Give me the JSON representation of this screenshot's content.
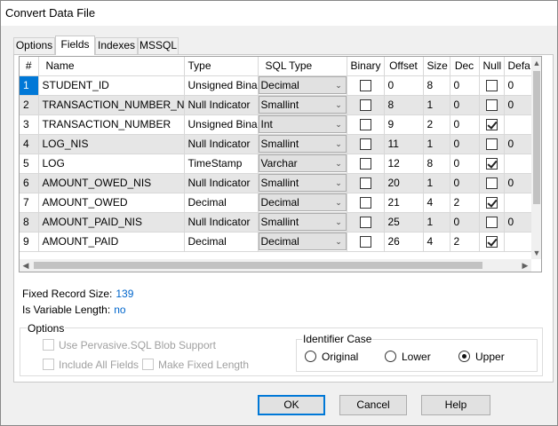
{
  "window": {
    "title": "Convert Data File"
  },
  "tabs": [
    {
      "label": "Options"
    },
    {
      "label": "Fields",
      "active": true
    },
    {
      "label": "Indexes"
    },
    {
      "label": "MSSQL"
    }
  ],
  "grid": {
    "columns": [
      "#",
      "Name",
      "Type",
      "SQL Type",
      "Binary",
      "Offset",
      "Size",
      "Dec",
      "Null",
      "Defa"
    ],
    "rows": [
      {
        "num": "1",
        "name": "STUDENT_ID",
        "type": "Unsigned Binary",
        "sql_type": "Decimal",
        "binary": false,
        "offset": "0",
        "size": "8",
        "dec": "0",
        "null": false,
        "default": "0"
      },
      {
        "num": "2",
        "name": "TRANSACTION_NUMBER_NIS",
        "type": "Null Indicator",
        "sql_type": "Smallint",
        "binary": false,
        "offset": "8",
        "size": "1",
        "dec": "0",
        "null": false,
        "default": "0"
      },
      {
        "num": "3",
        "name": "TRANSACTION_NUMBER",
        "type": "Unsigned Binary",
        "sql_type": "Int",
        "binary": false,
        "offset": "9",
        "size": "2",
        "dec": "0",
        "null": true,
        "default": ""
      },
      {
        "num": "4",
        "name": "LOG_NIS",
        "type": "Null Indicator",
        "sql_type": "Smallint",
        "binary": false,
        "offset": "11",
        "size": "1",
        "dec": "0",
        "null": false,
        "default": "0"
      },
      {
        "num": "5",
        "name": "LOG",
        "type": "TimeStamp",
        "sql_type": "Varchar",
        "binary": false,
        "offset": "12",
        "size": "8",
        "dec": "0",
        "null": true,
        "default": ""
      },
      {
        "num": "6",
        "name": "AMOUNT_OWED_NIS",
        "type": "Null Indicator",
        "sql_type": "Smallint",
        "binary": false,
        "offset": "20",
        "size": "1",
        "dec": "0",
        "null": false,
        "default": "0"
      },
      {
        "num": "7",
        "name": "AMOUNT_OWED",
        "type": "Decimal",
        "sql_type": "Decimal",
        "binary": false,
        "offset": "21",
        "size": "4",
        "dec": "2",
        "null": true,
        "default": ""
      },
      {
        "num": "8",
        "name": "AMOUNT_PAID_NIS",
        "type": "Null Indicator",
        "sql_type": "Smallint",
        "binary": false,
        "offset": "25",
        "size": "1",
        "dec": "0",
        "null": false,
        "default": "0"
      },
      {
        "num": "9",
        "name": "AMOUNT_PAID",
        "type": "Decimal",
        "sql_type": "Decimal",
        "binary": false,
        "offset": "26",
        "size": "4",
        "dec": "2",
        "null": true,
        "default": ""
      }
    ]
  },
  "info": {
    "fixed_record_size_label": "Fixed Record Size:",
    "fixed_record_size_value": "139",
    "variable_length_label": "Is Variable Length:",
    "variable_length_value": "no"
  },
  "options": {
    "group_label": "Options",
    "use_blob_support": {
      "label": "Use Pervasive.SQL Blob Support",
      "checked": false,
      "enabled": false
    },
    "include_all_fields": {
      "label": "Include All Fields",
      "checked": false,
      "enabled": false
    },
    "make_fixed_length": {
      "label": "Make Fixed Length",
      "checked": false,
      "enabled": false
    }
  },
  "identifier_case": {
    "label": "Identifier Case",
    "choices": [
      {
        "label": "Original",
        "selected": false
      },
      {
        "label": "Lower",
        "selected": false
      },
      {
        "label": "Upper",
        "selected": true
      }
    ]
  },
  "buttons": {
    "ok": "OK",
    "cancel": "Cancel",
    "help": "Help"
  },
  "colors": {
    "selection": "#0078d7",
    "link_value": "#0066cc",
    "alt_row": "#e6e6e6"
  }
}
